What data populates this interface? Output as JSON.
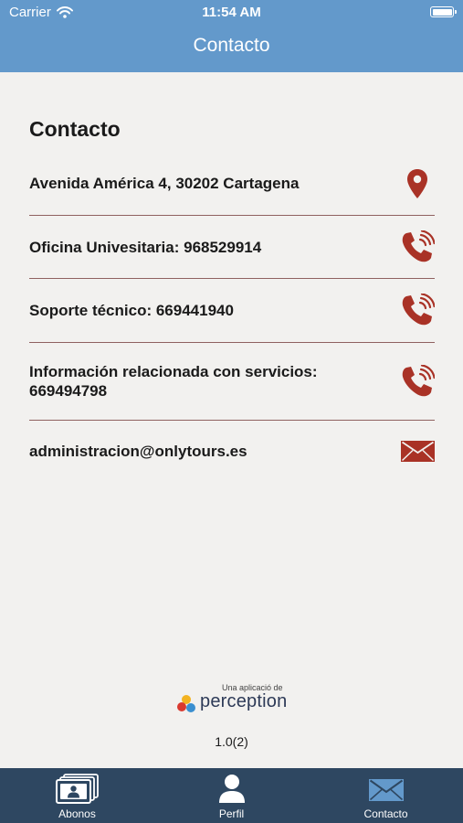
{
  "status": {
    "carrier": "Carrier",
    "time": "11:54 AM"
  },
  "nav": {
    "title": "Contacto"
  },
  "section": {
    "title": "Contacto"
  },
  "contacts": [
    {
      "text": "Avenida América 4, 30202 Cartagena",
      "icon": "location-pin-icon"
    },
    {
      "text": "Oficina Univesitaria: 968529914",
      "icon": "phone-icon"
    },
    {
      "text": "Soporte técnico: 669441940",
      "icon": "phone-icon"
    },
    {
      "text": "Información relacionada con servicios: 669494798",
      "icon": "phone-icon"
    },
    {
      "text": "administracion@onlytours.es",
      "icon": "mail-icon"
    }
  ],
  "branding": {
    "pre": "Una aplicació de",
    "name": "perception"
  },
  "version": "1.0(2)",
  "tabs": [
    {
      "label": "Abonos",
      "icon": "pass-cards-icon"
    },
    {
      "label": "Perfil",
      "icon": "person-icon"
    },
    {
      "label": "Contacto",
      "icon": "envelope-icon"
    }
  ],
  "colors": {
    "header": "#6399cb",
    "tabbar": "#2e4761",
    "accent": "#a93226",
    "divider": "#8f6160",
    "background": "#f2f1ef"
  }
}
